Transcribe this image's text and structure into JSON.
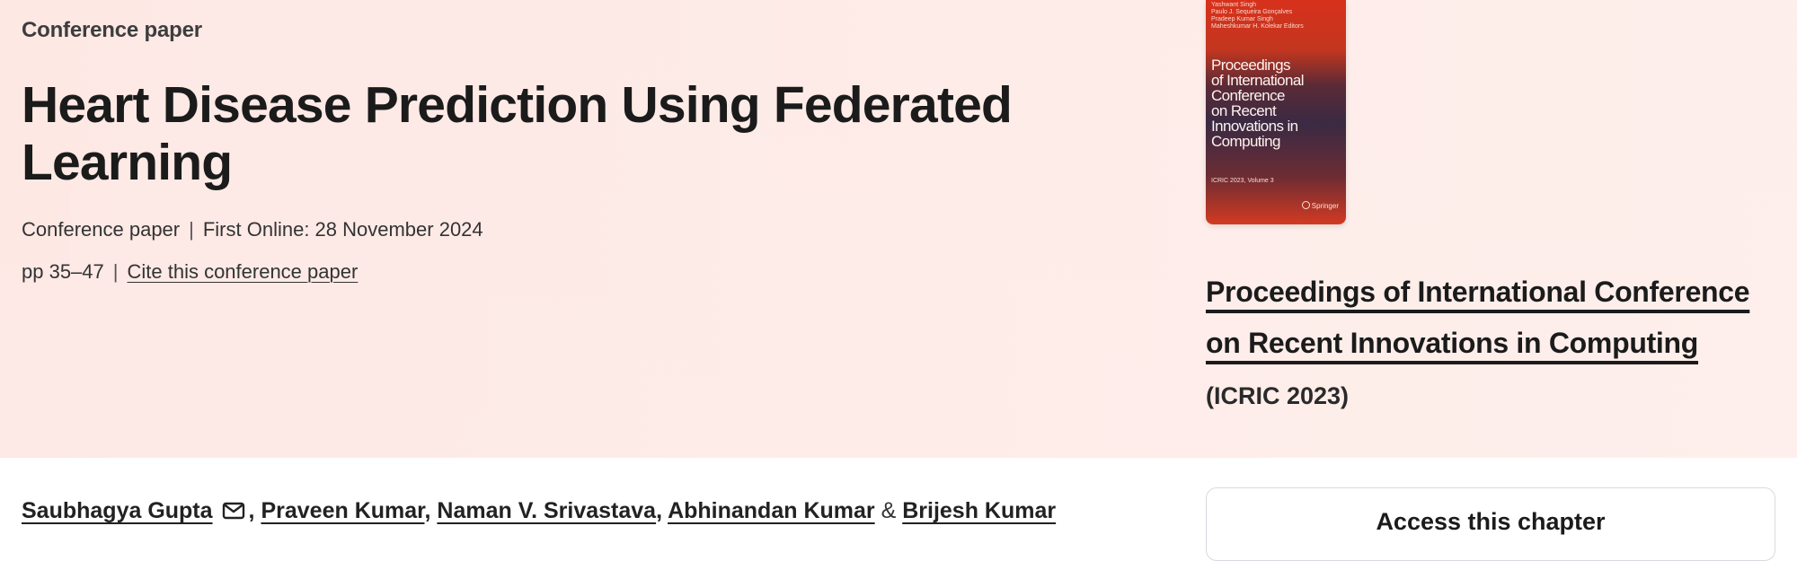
{
  "header": {
    "content_type": "Conference paper",
    "title": "Heart Disease Prediction Using Federated Learning",
    "meta": {
      "type": "Conference paper",
      "separator": "|",
      "first_online": "First Online: 28 November 2024",
      "pages": "pp 35–47",
      "cite_link": "Cite this conference paper"
    }
  },
  "book": {
    "cover": {
      "editors": "Yashwant Singh\nPaulo J. Sequeira Gonçalves\nPradeep Kumar Singh\nMaheshkumar H. Kolekar  Editors",
      "title": "Proceedings\nof International\nConference\non Recent\nInnovations in\nComputing",
      "volume": "ICRIC 2023, Volume 3",
      "publisher": "Springer"
    },
    "title": "Proceedings of International Conference on Recent Innovations in Computing",
    "acronym": "(ICRIC 2023)"
  },
  "authors": {
    "list": [
      {
        "name": "Saubhagya Gupta",
        "after": ""
      },
      {
        "name": "Praveen Kumar",
        "after": ", "
      },
      {
        "name": "Naman V. Srivastava",
        "after": ", "
      },
      {
        "name": "Abhinandan Kumar",
        "after": " & "
      },
      {
        "name": "Brijesh Kumar",
        "after": ""
      }
    ],
    "comma": ", ",
    "ampersand": " & "
  },
  "sidebar": {
    "access_title": "Access this chapter"
  },
  "icons": {
    "email": "mail-icon",
    "publisher_logo": "springer-horse-icon"
  },
  "colors": {
    "hero_background": "#fde8e4",
    "cover_top": "#d7311c",
    "cover_middle": "#3a2a44",
    "text": "#1b1b1b"
  }
}
